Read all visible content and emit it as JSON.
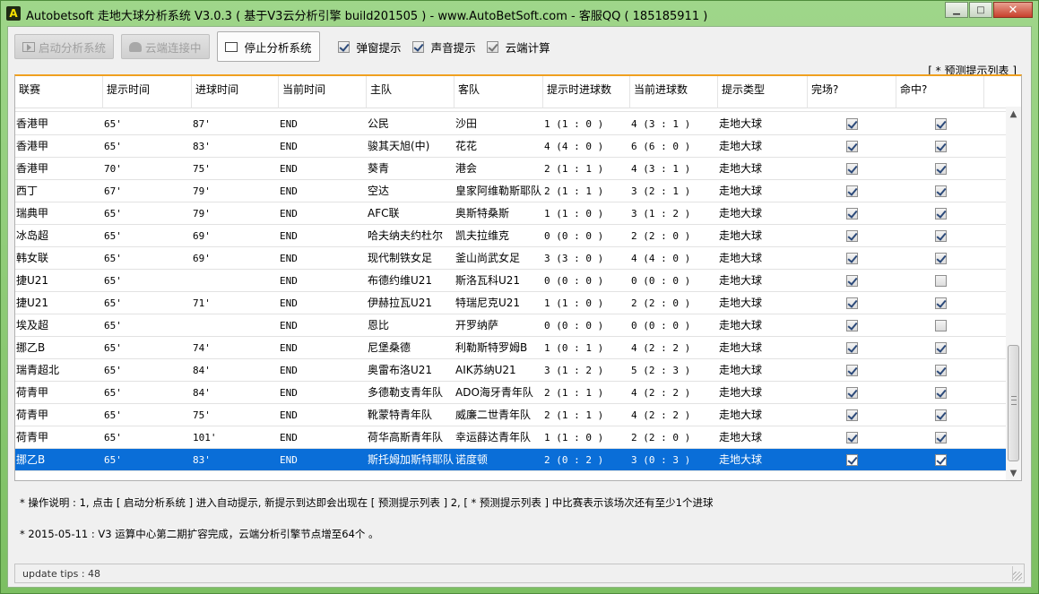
{
  "window": {
    "title": "Autobetsoft 走地大球分析系统 V3.0.3 ( 基于V3云分析引擎 build201505 ) - www.AutoBetSoft.com - 客服QQ ( 185185911 )",
    "icon_letter": "A",
    "controls": {
      "minimize": "▁",
      "maximize": "□",
      "close": "✕"
    }
  },
  "toolbar": {
    "start_label": "启动分析系统",
    "cloud_label": "云端连接中",
    "stop_label": "停止分析系统",
    "popup_label": "弹窗提示",
    "sound_label": "声音提示",
    "cloud_calc_label": "云端计算"
  },
  "list": {
    "title": "[ * 预测提示列表 ]",
    "columns": [
      "联赛",
      "提示时间",
      "进球时间",
      "当前时间",
      "主队",
      "客队",
      "提示时进球数",
      "当前进球数",
      "提示类型",
      "完场?",
      "命中?"
    ],
    "rows": [
      {
        "league": "香港甲",
        "hint_time": "65'",
        "goal_time": "87'",
        "cur_time": "END",
        "home": "公民",
        "away": "沙田",
        "hint_goals": "1 (1 : 0 )",
        "cur_goals": "4 (3 : 1 )",
        "type": "走地大球",
        "finished": true,
        "hit": true
      },
      {
        "league": "香港甲",
        "hint_time": "65'",
        "goal_time": "83'",
        "cur_time": "END",
        "home": "骏其天旭(中)",
        "away": "花花",
        "hint_goals": "4 (4 : 0 )",
        "cur_goals": "6 (6 : 0 )",
        "type": "走地大球",
        "finished": true,
        "hit": true
      },
      {
        "league": "香港甲",
        "hint_time": "70'",
        "goal_time": "75'",
        "cur_time": "END",
        "home": "葵青",
        "away": "港会",
        "hint_goals": "2 (1 : 1 )",
        "cur_goals": "4 (3 : 1 )",
        "type": "走地大球",
        "finished": true,
        "hit": true
      },
      {
        "league": "西丁",
        "hint_time": "67'",
        "goal_time": "79'",
        "cur_time": "END",
        "home": "空达",
        "away": "皇家阿维勒斯耶队",
        "hint_goals": "2 (1 : 1 )",
        "cur_goals": "3 (2 : 1 )",
        "type": "走地大球",
        "finished": true,
        "hit": true
      },
      {
        "league": "瑞典甲",
        "hint_time": "65'",
        "goal_time": "79'",
        "cur_time": "END",
        "home": "AFC联",
        "away": "奥斯特桑斯",
        "hint_goals": "1 (1 : 0 )",
        "cur_goals": "3 (1 : 2 )",
        "type": "走地大球",
        "finished": true,
        "hit": true
      },
      {
        "league": "冰岛超",
        "hint_time": "65'",
        "goal_time": "69'",
        "cur_time": "END",
        "home": "哈夫纳夫约杜尔",
        "away": "凯夫拉维克",
        "hint_goals": "0 (0 : 0 )",
        "cur_goals": "2 (2 : 0 )",
        "type": "走地大球",
        "finished": true,
        "hit": true
      },
      {
        "league": "韩女联",
        "hint_time": "65'",
        "goal_time": "69'",
        "cur_time": "END",
        "home": "现代制铁女足",
        "away": "釜山尚武女足",
        "hint_goals": "3 (3 : 0 )",
        "cur_goals": "4 (4 : 0 )",
        "type": "走地大球",
        "finished": true,
        "hit": true
      },
      {
        "league": "捷U21",
        "hint_time": "65'",
        "goal_time": "",
        "cur_time": "END",
        "home": "布德约维U21",
        "away": "斯洛瓦科U21",
        "hint_goals": "0 (0 : 0 )",
        "cur_goals": "0 (0 : 0 )",
        "type": "走地大球",
        "finished": true,
        "hit": false
      },
      {
        "league": "捷U21",
        "hint_time": "65'",
        "goal_time": "71'",
        "cur_time": "END",
        "home": "伊赫拉瓦U21",
        "away": "特瑞尼克U21",
        "hint_goals": "1 (1 : 0 )",
        "cur_goals": "2 (2 : 0 )",
        "type": "走地大球",
        "finished": true,
        "hit": true
      },
      {
        "league": "埃及超",
        "hint_time": "65'",
        "goal_time": "",
        "cur_time": "END",
        "home": "恩比",
        "away": "开罗纳萨",
        "hint_goals": "0 (0 : 0 )",
        "cur_goals": "0 (0 : 0 )",
        "type": "走地大球",
        "finished": true,
        "hit": false
      },
      {
        "league": "挪乙B",
        "hint_time": "65'",
        "goal_time": "74'",
        "cur_time": "END",
        "home": "尼堡桑德",
        "away": "利勒斯特罗姆B",
        "hint_goals": "1 (0 : 1 )",
        "cur_goals": "4 (2 : 2 )",
        "type": "走地大球",
        "finished": true,
        "hit": true
      },
      {
        "league": "瑞青超北",
        "hint_time": "65'",
        "goal_time": "84'",
        "cur_time": "END",
        "home": "奥雷布洛U21",
        "away": "AIK苏纳U21",
        "hint_goals": "3 (1 : 2 )",
        "cur_goals": "5 (2 : 3 )",
        "type": "走地大球",
        "finished": true,
        "hit": true
      },
      {
        "league": "荷青甲",
        "hint_time": "65'",
        "goal_time": "84'",
        "cur_time": "END",
        "home": "多德勒支青年队",
        "away": "ADO海牙青年队",
        "hint_goals": "2 (1 : 1 )",
        "cur_goals": "4 (2 : 2 )",
        "type": "走地大球",
        "finished": true,
        "hit": true
      },
      {
        "league": "荷青甲",
        "hint_time": "65'",
        "goal_time": "75'",
        "cur_time": "END",
        "home": "靴蒙特青年队",
        "away": "威廉二世青年队",
        "hint_goals": "2 (1 : 1 )",
        "cur_goals": "4 (2 : 2 )",
        "type": "走地大球",
        "finished": true,
        "hit": true
      },
      {
        "league": "荷青甲",
        "hint_time": "65'",
        "goal_time": "101'",
        "cur_time": "END",
        "home": "荷华高斯青年队",
        "away": "幸运薛达青年队",
        "hint_goals": "1 (1 : 0 )",
        "cur_goals": "2 (2 : 0 )",
        "type": "走地大球",
        "finished": true,
        "hit": true
      },
      {
        "league": "挪乙B",
        "hint_time": "65'",
        "goal_time": "83'",
        "cur_time": "END",
        "home": "斯托姆加斯特耶队",
        "away": "诺度顿",
        "hint_goals": "2 (0 : 2 )",
        "cur_goals": "3 (0 : 3 )",
        "type": "走地大球",
        "finished": true,
        "hit": true
      }
    ],
    "selected_index": 15
  },
  "info": {
    "line1": "* 操作说明 : 1, 点击 [ 启动分析系统 ] 进入自动提示, 新提示到达即会出现在 [ 预测提示列表 ]   2, [ * 预测提示列表 ] 中比赛表示该场次还有至少1个进球",
    "line2": "* 2015-05-11 :   V3 运算中心第二期扩容完成，云端分析引擎节点增至64个 。"
  },
  "status": {
    "text": "update tips : 48"
  },
  "colors": {
    "selected": "#0a6ed8",
    "header_accent": "#f0a020",
    "frame": "#7cbf62"
  }
}
